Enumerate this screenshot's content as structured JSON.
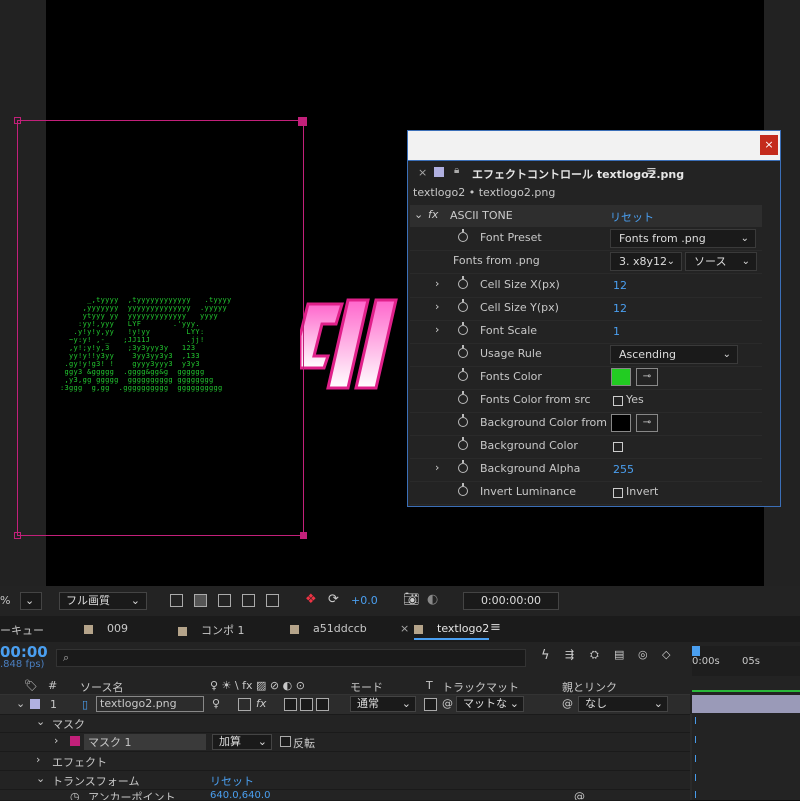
{
  "viewer": {
    "ascii_lines": [
      "      _,tyyyy  ,tyyyyyyyyyyyy   .tyyyy",
      "     ,yyyyyyy  yyyyyyyyyyyyyy  .yyyyy",
      "     ytyyy yy  yyyyyyyyyyyyy   yyyy",
      "    :yy!,yyy   LYF       .'yyy.",
      "   .y!y!y,yy   !y!yy        LYY:",
      "  ~y:y! ,-_   ;JJ11J        .jj!",
      "  ,y!;y!y,3    ;3y3yyy3y   123",
      "  yy!y!!y3yy    3yy3yy3y3  ,133",
      " .gy!y!g3! !    gyyy3yyy3  y3y3",
      " ggy3 &ggggg  .gggg&gg&g  gggggg",
      " ,y3,gg ggggg  gggggggggg gggggggg",
      ":3ggg  g,gg  .gggggggggg  gggggggggg"
    ],
    "colors": {
      "ascii_green": "#22c830",
      "logo_pink": "#e0208a",
      "layer_outline": "#c2207a"
    }
  },
  "effect_panel": {
    "tab_title": "エフェクトコントロール textlogo2.png",
    "menu_icon": "hamburger-icon",
    "breadcrumb": "textlogo2 • textlogo2.png",
    "effect_name": "ASCII TONE",
    "reset_label": "リセット",
    "font_preset": {
      "label": "Font Preset",
      "value": "Fonts from .png"
    },
    "fonts_from_png": {
      "label": "Fonts from .png",
      "font_value": "3. x8y12",
      "source_value": "ソース"
    },
    "cell_size_x": {
      "label": "Cell Size X(px)",
      "value": "12"
    },
    "cell_size_y": {
      "label": "Cell Size Y(px)",
      "value": "12"
    },
    "font_scale": {
      "label": "Font Scale",
      "value": "1"
    },
    "usage_rule": {
      "label": "Usage Rule",
      "value": "Ascending"
    },
    "fonts_color": {
      "label": "Fonts Color",
      "swatch": "#22cc22"
    },
    "fonts_color_from_src": {
      "label": "Fonts Color from src",
      "check_label": "Yes"
    },
    "bg_color_from_src": {
      "label": "Background Color from sr",
      "swatch": "#000000"
    },
    "bg_color": {
      "label": "Background Color"
    },
    "bg_alpha": {
      "label": "Background Alpha",
      "value": "255"
    },
    "invert_luminance": {
      "label": "Invert Luminance",
      "check_label": "Invert"
    },
    "close_glyph": "×",
    "fx_glyph": "fx"
  },
  "viewer_toolbar": {
    "zoom_fragment": "%",
    "quality": "フル画質",
    "exposure": "+0.0",
    "timecode": "0:00:00:00"
  },
  "timeline_tabs": {
    "render_queue_fragment": "ーキュー",
    "tabs": [
      "009",
      "コンポ 1",
      "a51ddccb",
      "textlogo2"
    ]
  },
  "timeline": {
    "current_time": "00:00",
    "fps": ".848 fps)",
    "search_placeholder": "",
    "columns": {
      "hash": "#",
      "source_name": "ソース名",
      "switches": "♀ ☀ \\ fx ▨ ⊘ ◐ ⊙",
      "mode": "モード",
      "t": "T",
      "track_matte": "トラックマット",
      "parent": "親とリンク"
    },
    "ruler": {
      "start": "0:00s",
      "mid": "05s"
    },
    "layer": {
      "index": "1",
      "name": "textlogo2.png",
      "mode": "通常",
      "matte": "マットな",
      "parent": "なし"
    },
    "rows": {
      "mask_group": "マスク",
      "mask1": "マスク 1",
      "mask_mode": "加算",
      "invert": "反転",
      "effect": "エフェクト",
      "transform": "トランスフォーム",
      "transform_reset": "リセット",
      "anchor": "アンカーポイント",
      "anchor_value": "640.0,640.0"
    }
  }
}
